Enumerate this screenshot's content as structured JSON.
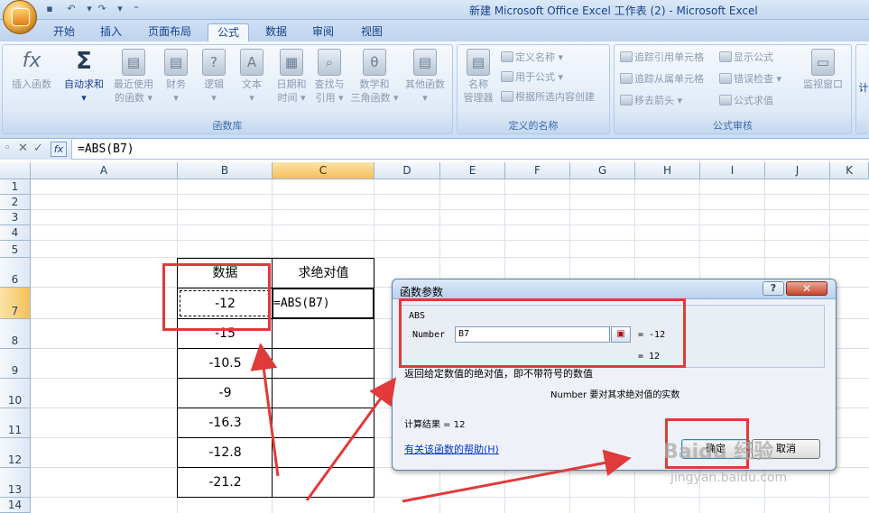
{
  "window": {
    "title": "新建 Microsoft Office Excel 工作表 (2) - Microsoft Excel"
  },
  "ribbon": {
    "tabs": [
      "开始",
      "插入",
      "页面布局",
      "公式",
      "数据",
      "审阅",
      "视图"
    ],
    "active_tab": "公式",
    "groups": {
      "function_library": {
        "label": "函数库",
        "buttons": [
          "插入函数",
          "自动求和",
          "最近使用的函数",
          "财务",
          "逻辑",
          "文本",
          "日期和时间",
          "查找与引用",
          "数学和三角函数",
          "其他函数"
        ],
        "button_lines": [
          [
            "插入函数",
            ""
          ],
          [
            "自动求和",
            ""
          ],
          [
            "最近使用",
            "的函数 ▾"
          ],
          [
            "财务",
            "▾"
          ],
          [
            "逻辑",
            "▾"
          ],
          [
            "文本",
            "▾"
          ],
          [
            "日期和",
            "时间 ▾"
          ],
          [
            "查找与",
            "引用 ▾"
          ],
          [
            "数学和",
            "三角函数 ▾"
          ],
          [
            "其他函数",
            "▾"
          ]
        ]
      },
      "defined_names": {
        "label": "定义的名称",
        "name_manager": [
          "名称",
          "管理器"
        ],
        "define_name": "定义名称 ▾",
        "use_in_formula": "用于公式 ▾",
        "create_from_selection": "根据所选内容创建"
      },
      "formula_auditing": {
        "label": "公式审核",
        "trace_precedents": "追踪引用单元格",
        "trace_dependents": "追踪从属单元格",
        "remove_arrows": "移去箭头 ▾",
        "show_formulas": "显示公式",
        "error_checking": "错误检查 ▾",
        "evaluate_formula": "公式求值",
        "watch_window": "监视窗口",
        "calc_partial": "计"
      }
    }
  },
  "formula_bar": {
    "fx_label": "fx",
    "formula": "=ABS(B7)"
  },
  "sheet": {
    "columns": [
      "A",
      "B",
      "C",
      "D",
      "E",
      "F",
      "G",
      "H",
      "I",
      "J",
      "K"
    ],
    "selected_column": "C",
    "rows": [
      "1",
      "2",
      "3",
      "4",
      "5",
      "6",
      "7",
      "8",
      "9",
      "10",
      "11",
      "12",
      "13",
      "14"
    ],
    "selected_row": "7",
    "header_b6": "数据",
    "header_c6": "求绝对值",
    "c7_formula": "=ABS(B7)",
    "data_values": [
      "-12",
      "-15",
      "-10.5",
      "-9",
      "-16.3",
      "-12.8",
      "-21.2"
    ]
  },
  "dialog": {
    "title": "函数参数",
    "help_button": "?",
    "close_button": "✕",
    "function_name": "ABS",
    "arg_label": "Number",
    "arg_value": "B7",
    "arg_eval": "=  -12",
    "result_eval": "=  12",
    "description": "返回给定数值的绝对值，即不带符号的数值",
    "arg_description": "Number  要对其求绝对值的实数",
    "calc_result": "计算结果 =  12",
    "help_link": "有关该函数的帮助(H)",
    "ok_label": "确定",
    "cancel_label": "取消"
  },
  "watermark": {
    "brand": "Baidu 经验",
    "url": "jingyan.baidu.com"
  },
  "colors": {
    "annotation_red": "#e03a3a",
    "selected_header": "#f4c05a",
    "ribbon_blue": "#dde9f7"
  }
}
